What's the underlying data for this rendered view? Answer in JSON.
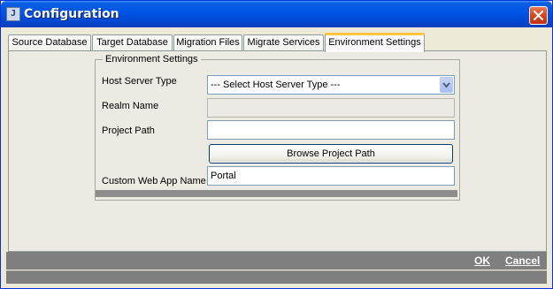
{
  "window": {
    "title": "Configuration",
    "icon_name": "app-icon",
    "icon_glyph": "J"
  },
  "tabs": [
    {
      "label": "Source Database",
      "active": false
    },
    {
      "label": "Target Database",
      "active": false
    },
    {
      "label": "Migration Files",
      "active": false
    },
    {
      "label": "Migrate Services",
      "active": false
    },
    {
      "label": "Environment Settings",
      "active": true
    }
  ],
  "group": {
    "legend": "Environment Settings",
    "host_server_type": {
      "label": "Host Server Type",
      "selected": "--- Select Host Server Type ---"
    },
    "realm_name": {
      "label": "Realm Name",
      "value": ""
    },
    "project_path": {
      "label": "Project Path",
      "value": ""
    },
    "browse_button": "Browse Project Path",
    "custom_web_app": {
      "label": "Custom Web App Name",
      "value": "Portal"
    }
  },
  "footer": {
    "ok": "OK",
    "cancel": "Cancel"
  },
  "colors": {
    "titlebar": "#0055e5",
    "active_tab_accent": "#ffc83c",
    "footer_bg": "#7f7f7f"
  }
}
